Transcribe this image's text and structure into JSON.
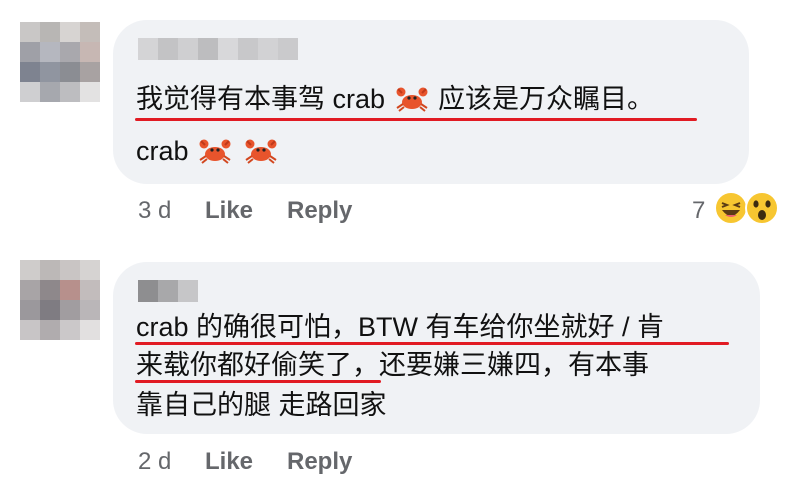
{
  "comments": [
    {
      "line1_before": "我觉得有本事驾 crab",
      "line1_after": "应该是万众瞩目。",
      "line2": "crab",
      "line2_icons": [
        "crab-emoji",
        "crab-emoji"
      ],
      "time": "3 d",
      "like": "Like",
      "reply": "Reply",
      "reaction_count": "7",
      "reactions": [
        "laughing-emoji",
        "wow-emoji"
      ]
    },
    {
      "line1": "crab 的确很可怕，BTW 有车给你坐就好 / 肯",
      "line2": "来载你都好偷笑了，还要嫌三嫌四，有本事",
      "line3": "靠自己的腿 走路回家",
      "time": "2 d",
      "like": "Like",
      "reply": "Reply"
    }
  ],
  "colors": {
    "bubble": "#f0f2f5",
    "highlight_underline": "#e11b23",
    "meta_text": "#65676b",
    "body_text": "#111111"
  }
}
